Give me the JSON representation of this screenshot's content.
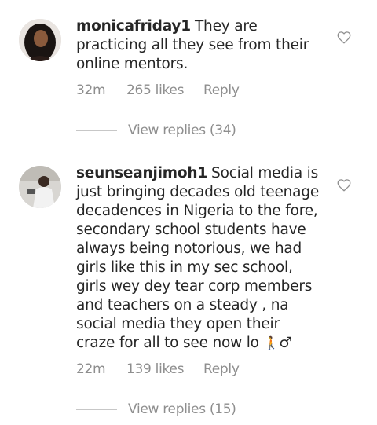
{
  "comments": [
    {
      "username": "monicafriday1",
      "text": "They are practicing all they see from their online mentors.",
      "time": "32m",
      "likes": "265 likes",
      "reply": "Reply",
      "view_replies": "View replies (34)"
    },
    {
      "username": "seunseanjimoh1",
      "text": "Social media is just bringing decades old teenage decadences in Nigeria to the fore, secondary school students have always being notorious, we had girls like this in my sec school, girls wey dey tear corp members and teachers on a steady , na social media they open their craze for all to see now lo",
      "emoji": "🚶",
      "emoji_suffix": "♂",
      "time": "22m",
      "likes": "139 likes",
      "reply": "Reply",
      "view_replies": "View replies (15)"
    }
  ],
  "icons": {
    "like": "heart-outline-icon"
  },
  "colors": {
    "text": "#262626",
    "secondary": "#8e8e8e",
    "divider": "#c7c7c7",
    "emoji": "#f5b400"
  }
}
